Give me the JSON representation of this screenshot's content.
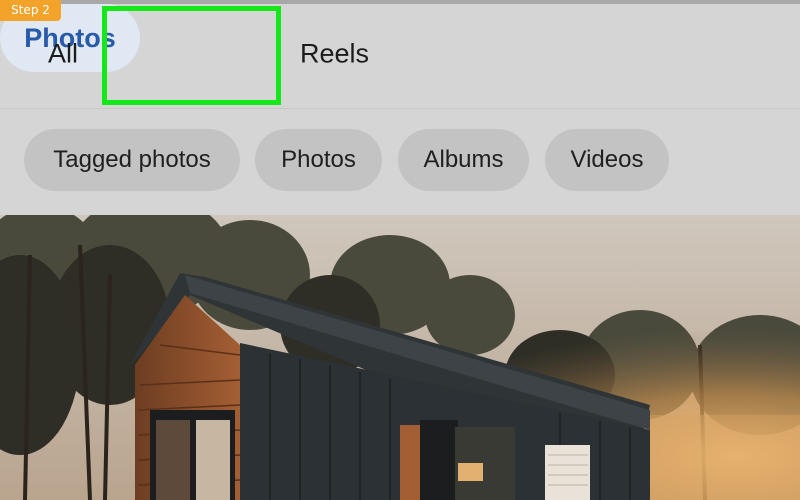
{
  "step_badge": "Step 2",
  "tabs": {
    "all": "All",
    "photos": "Photos",
    "reels": "Reels"
  },
  "filters": [
    {
      "label": "Tagged photos"
    },
    {
      "label": "Photos"
    },
    {
      "label": "Albums"
    },
    {
      "label": "Videos"
    }
  ],
  "colors": {
    "highlight": "#15e818",
    "active_tab_text": "#275aa8",
    "badge": "#f3a32a"
  },
  "photo": {
    "subject": "tiny-cabin-in-forest"
  }
}
